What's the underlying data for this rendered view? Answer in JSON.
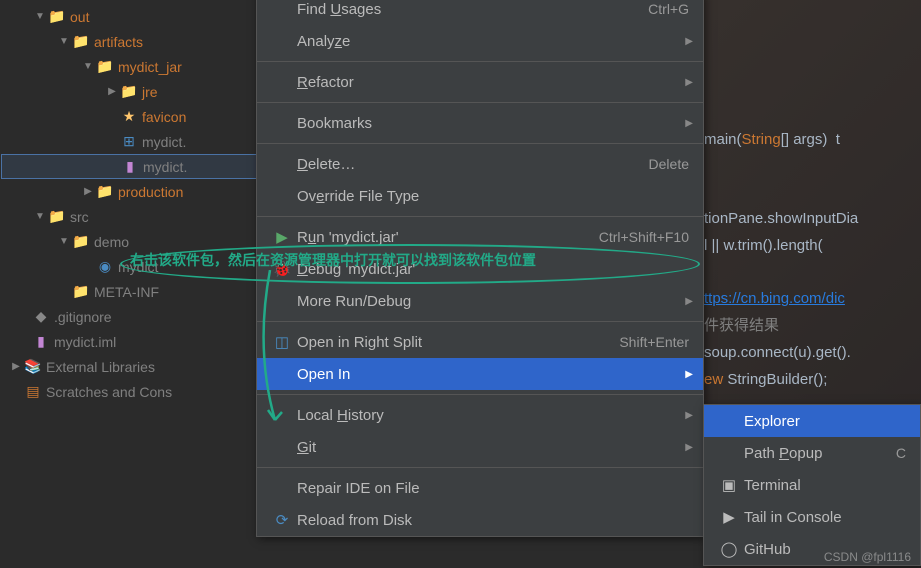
{
  "tree": {
    "out": "out",
    "artifacts": "artifacts",
    "mydict_jar": "mydict_jar",
    "jre": "jre",
    "favicon": "favicon",
    "mydict_exe": "mydict.",
    "mydict_jar_file": "mydict.",
    "production": "production",
    "src": "src",
    "demo": "demo",
    "mydict_class": "mydict",
    "meta_inf": "META-INF",
    "gitignore": ".gitignore",
    "mydict_iml": "mydict.iml",
    "external": "External Libraries",
    "scratches": "Scratches and Cons"
  },
  "menu1": {
    "find_usages": "Find Usages",
    "find_usages_sc": "Ctrl+G",
    "analyze": "Analyze",
    "refactor": "Refactor",
    "bookmarks": "Bookmarks",
    "delete": "Delete…",
    "delete_sc": "Delete",
    "override": "Override File Type",
    "run": "Run 'mydict.jar'",
    "run_sc": "Ctrl+Shift+F10",
    "debug": "Debug 'mydict.jar'",
    "more_run": "More Run/Debug",
    "open_split": "Open in Right Split",
    "open_split_sc": "Shift+Enter",
    "open_in": "Open In",
    "local_history": "Local History",
    "git": "Git",
    "repair": "Repair IDE on File",
    "reload": "Reload from Disk"
  },
  "menu2": {
    "explorer": "Explorer",
    "path_popup": "Path Popup",
    "path_popup_sc": "C",
    "terminal": "Terminal",
    "tail": "Tail in Console",
    "github": "GitHub"
  },
  "code": {
    "l1a": "main(",
    "l1b": "String",
    "l1c": "[] args)  t",
    "l2a": "tionPane",
    "l2b": ".showInputDia",
    "l3a": "l || w.trim().length(",
    "l4": "ttps://cn.bing.com/dic",
    "l5": "件获得结果",
    "l6": "soup.connect(u).get().",
    "l7a": "ew ",
    "l7b": "StringBuilder();"
  },
  "annotation": "右击该软件包，然后在资源管理器中打开就可以找到该软件包位置",
  "watermark": "CSDN @fpl1116"
}
